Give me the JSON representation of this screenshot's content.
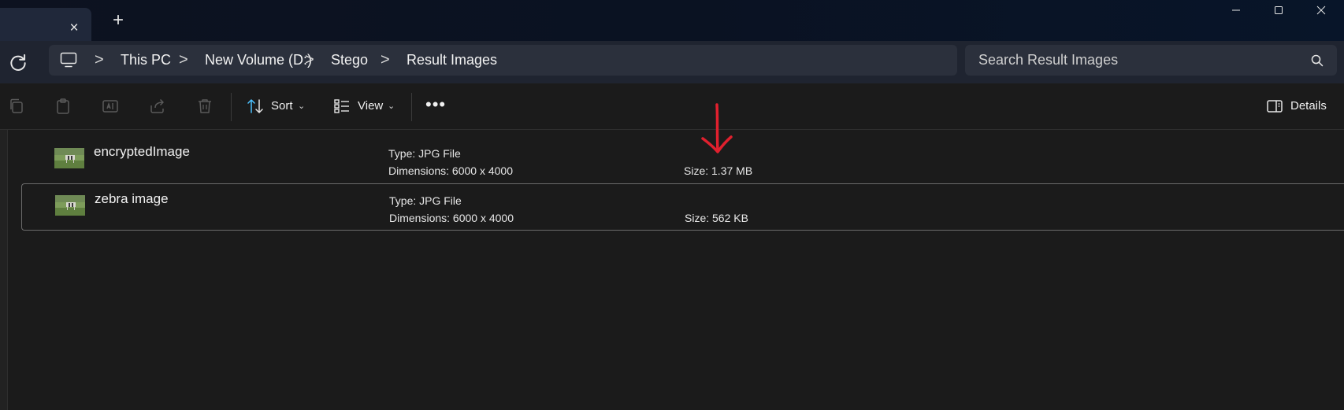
{
  "tab": {
    "close_icon": "×",
    "add_icon": "+"
  },
  "window_controls": {
    "minimize": "—",
    "maximize": "☐",
    "close": "✕"
  },
  "breadcrumb": {
    "items": [
      "This PC",
      "New Volume (D:)",
      "Stego",
      "Result Images"
    ],
    "separator": ">"
  },
  "search": {
    "placeholder": "Search Result Images"
  },
  "toolbar": {
    "sort_label": "Sort",
    "view_label": "View",
    "more_label": "•••",
    "details_label": "Details"
  },
  "files": [
    {
      "name": "encryptedImage",
      "type": "Type: JPG File",
      "dimensions": "Dimensions: 6000 x 4000",
      "size": "Size: 1.37 MB",
      "selected": false
    },
    {
      "name": "zebra image",
      "type": "Type: JPG File",
      "dimensions": "Dimensions: 6000 x 4000",
      "size": "Size: 562 KB",
      "selected": true
    }
  ],
  "colors": {
    "annotation_arrow": "#e0202e",
    "accent": "#4cc2ff"
  }
}
